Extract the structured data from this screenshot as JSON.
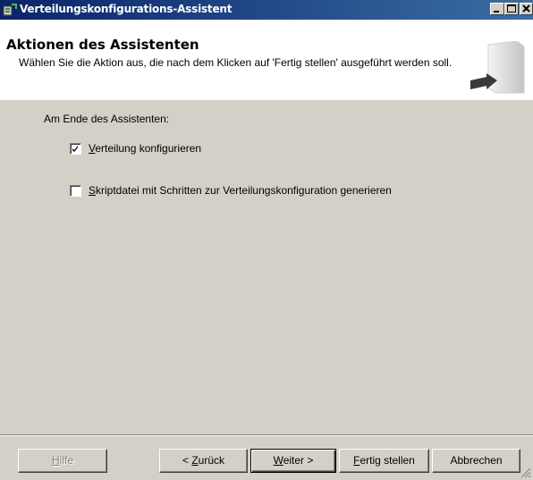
{
  "window": {
    "title": "Verteilungskonfigurations-Assistent",
    "buttons": {
      "minimize": "_",
      "maximize": "□",
      "close": "X"
    }
  },
  "header": {
    "title": "Aktionen des Assistenten",
    "description": "Wählen Sie die Aktion aus, die nach dem Klicken auf 'Fertig stellen' ausgeführt werden soll."
  },
  "main": {
    "section_label": "Am Ende des Assistenten:",
    "options": [
      {
        "accel": "V",
        "rest": "erteilung konfigurieren",
        "checked": true
      },
      {
        "accel": "S",
        "rest": "kriptdatei mit Schritten zur Verteilungskonfiguration generieren",
        "checked": false
      }
    ]
  },
  "footer": {
    "help": {
      "accel": "H",
      "rest": "ilfe",
      "enabled": false
    },
    "back": {
      "prefix": "< ",
      "accel": "Z",
      "rest": "urück"
    },
    "next": {
      "accel": "W",
      "rest": "eiter >"
    },
    "finish": {
      "accel": "F",
      "rest": "ertig stellen"
    },
    "cancel": {
      "label": "Abbrechen"
    }
  }
}
